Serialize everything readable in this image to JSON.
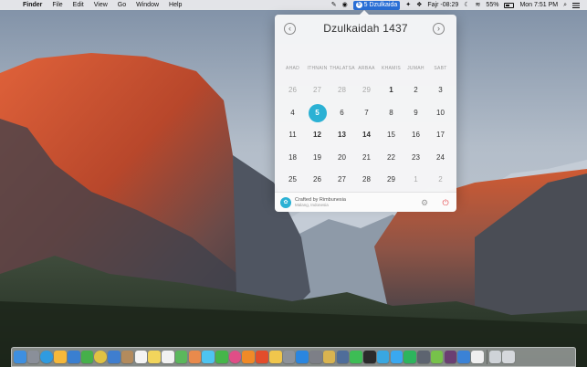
{
  "menubar": {
    "apple_glyph": "",
    "app_name": "Finder",
    "menus": [
      "File",
      "Edit",
      "View",
      "Go",
      "Window",
      "Help"
    ],
    "status_item": {
      "icon": "5",
      "label": "5 Dzulkaida"
    },
    "prayer": "Fajr -08:29",
    "battery": "55%",
    "clock": "Mon 7:51 PM",
    "right_icons": [
      "script-icon",
      "twitter-icon",
      "bird-icon",
      "moon-icon",
      "wifi-icon",
      "search-icon",
      "list-icon"
    ]
  },
  "calendar": {
    "title": "Dzulkaidah 1437",
    "prev_glyph": "‹",
    "next_glyph": "›",
    "weekdays": [
      "AHAD",
      "ITHNAIN",
      "THALATSA",
      "ARBAA",
      "KHAMIS",
      "JUMAH",
      "SABT"
    ],
    "weeks": [
      [
        {
          "d": "26",
          "m": true
        },
        {
          "d": "27",
          "m": true
        },
        {
          "d": "28",
          "m": true
        },
        {
          "d": "29",
          "m": true
        },
        {
          "d": "1",
          "b": true
        },
        {
          "d": "2"
        },
        {
          "d": "3"
        }
      ],
      [
        {
          "d": "4"
        },
        {
          "d": "5",
          "today": true
        },
        {
          "d": "6"
        },
        {
          "d": "7"
        },
        {
          "d": "8"
        },
        {
          "d": "9"
        },
        {
          "d": "10"
        }
      ],
      [
        {
          "d": "11"
        },
        {
          "d": "12",
          "b": true
        },
        {
          "d": "13",
          "b": true
        },
        {
          "d": "14",
          "b": true
        },
        {
          "d": "15"
        },
        {
          "d": "16"
        },
        {
          "d": "17"
        }
      ],
      [
        {
          "d": "18"
        },
        {
          "d": "19"
        },
        {
          "d": "20"
        },
        {
          "d": "21"
        },
        {
          "d": "22"
        },
        {
          "d": "23"
        },
        {
          "d": "24"
        }
      ],
      [
        {
          "d": "25"
        },
        {
          "d": "26"
        },
        {
          "d": "27"
        },
        {
          "d": "28"
        },
        {
          "d": "29"
        },
        {
          "d": "1",
          "m": true
        },
        {
          "d": "2",
          "m": true
        }
      ]
    ],
    "footer": {
      "credit": "Crafted by Rimbunesia",
      "location": "Malang, Indonesia",
      "settings_glyph": "⚙",
      "power_glyph": "⏻"
    },
    "accent_color": "#2bb1d4"
  },
  "dock": {
    "apps": [
      {
        "name": "finder",
        "color": "#3d8fe0"
      },
      {
        "name": "launchpad",
        "color": "#8a8f99"
      },
      {
        "name": "safari",
        "color": "#2f9be0"
      },
      {
        "name": "sketch",
        "color": "#f6b83a"
      },
      {
        "name": "app-store-blue",
        "color": "#3a7fd0"
      },
      {
        "name": "evernote",
        "color": "#46b04a"
      },
      {
        "name": "chrome",
        "color": "#e0c243"
      },
      {
        "name": "preview",
        "color": "#3f7ecf"
      },
      {
        "name": "contacts",
        "color": "#b38b5d"
      },
      {
        "name": "calendar",
        "color": "#f4f4f4"
      },
      {
        "name": "notes",
        "color": "#f2d55c"
      },
      {
        "name": "reminders",
        "color": "#f1f1f1"
      },
      {
        "name": "maps",
        "color": "#5bb85c"
      },
      {
        "name": "photos",
        "color": "#e98a4c"
      },
      {
        "name": "messages",
        "color": "#4ec4f0"
      },
      {
        "name": "facetime",
        "color": "#45b649"
      },
      {
        "name": "itunes",
        "color": "#e04e87"
      },
      {
        "name": "ibooks",
        "color": "#f08a27"
      },
      {
        "name": "vlc",
        "color": "#e34c2b"
      },
      {
        "name": "mail",
        "color": "#f0c64c"
      },
      {
        "name": "system-preferences",
        "color": "#8e939a"
      },
      {
        "name": "app-store",
        "color": "#2a86e0"
      },
      {
        "name": "automator",
        "color": "#7d7f87"
      },
      {
        "name": "coin",
        "color": "#d9b450"
      },
      {
        "name": "tunnelblick",
        "color": "#4f6d9a"
      },
      {
        "name": "whatsapp",
        "color": "#3dbd55"
      },
      {
        "name": "terminal",
        "color": "#2b2b2b"
      },
      {
        "name": "telegram",
        "color": "#39a7e0"
      },
      {
        "name": "twitter",
        "color": "#3aa8f0"
      },
      {
        "name": "spotify",
        "color": "#2db55d"
      },
      {
        "name": "activity-monitor",
        "color": "#5d6470"
      },
      {
        "name": "android-studio",
        "color": "#77c24a"
      },
      {
        "name": "slack",
        "color": "#6b3f72"
      },
      {
        "name": "xcode",
        "color": "#3b82d6"
      },
      {
        "name": "textedit",
        "color": "#efefef"
      }
    ],
    "trailing": [
      {
        "name": "downloads-stack",
        "color": "#cfd3d8"
      },
      {
        "name": "trash",
        "color": "#d5d8dc"
      }
    ]
  }
}
